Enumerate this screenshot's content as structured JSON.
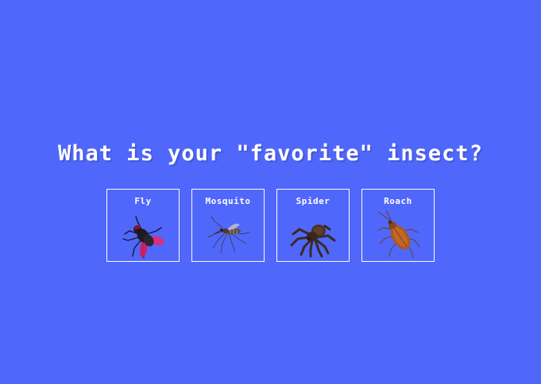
{
  "question": "What is your \"favorite\" insect?",
  "options": [
    {
      "label": "Fly",
      "icon": "fly-icon"
    },
    {
      "label": "Mosquito",
      "icon": "mosquito-icon"
    },
    {
      "label": "Spider",
      "icon": "spider-icon"
    },
    {
      "label": "Roach",
      "icon": "roach-icon"
    }
  ],
  "colors": {
    "background": "#5067fb",
    "text": "#ffffff",
    "border": "#ffffff"
  }
}
